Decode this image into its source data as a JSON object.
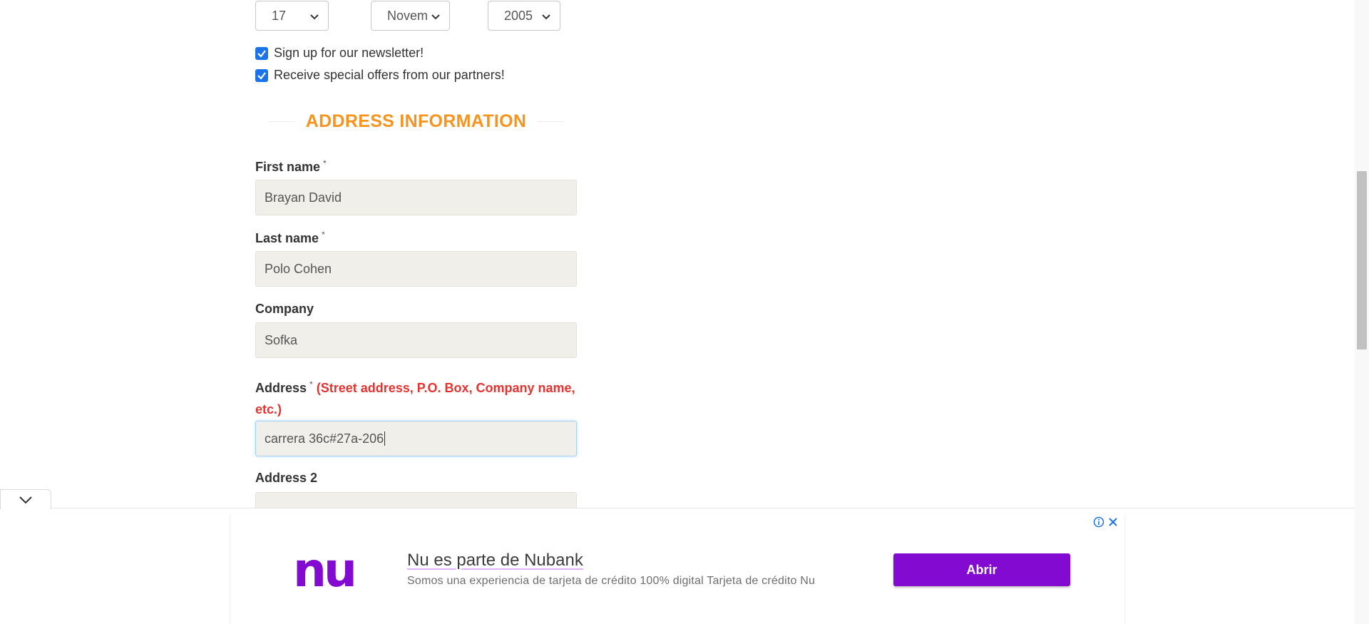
{
  "dob": {
    "day": "17",
    "month": "Novem",
    "year": "2005"
  },
  "checkboxes": {
    "newsletter": "Sign up for our newsletter!",
    "offers": "Receive special offers from our partners!"
  },
  "section_title": "ADDRESS INFORMATION",
  "fields": {
    "first_name": {
      "label": "First name",
      "required": "*",
      "value": "Brayan David"
    },
    "last_name": {
      "label": "Last name",
      "required": "*",
      "value": "Polo Cohen"
    },
    "company": {
      "label": "Company",
      "value": "Sofka"
    },
    "address": {
      "label": "Address",
      "required": "*",
      "hint_line1": "(Street address, P.O. Box, Company name,",
      "hint_line2": "etc.)",
      "value": "carrera 36c#27a-206"
    },
    "address2": {
      "label": "Address 2",
      "value": ""
    }
  },
  "ad": {
    "logo": "nu",
    "title": "Nu es parte de Nubank",
    "description": "Somos una experiencia de tarjeta de crédito 100% digital Tarjeta de crédito Nu",
    "button": "Abrir",
    "brand_color": "#820ad1"
  },
  "colors": {
    "accent": "#f7941d",
    "hint": "#e8322f",
    "checkbox": "#1a73e8"
  }
}
